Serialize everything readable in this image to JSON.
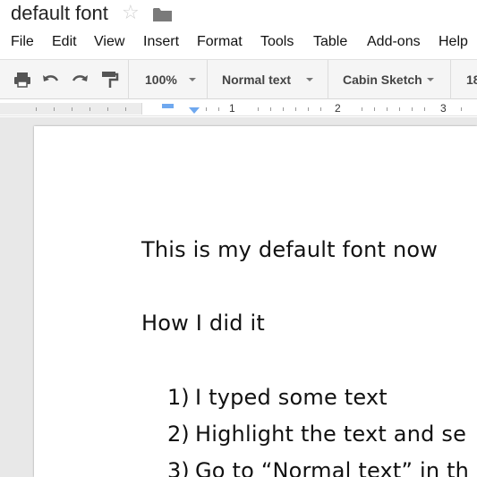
{
  "app": {
    "doc_title": "default font"
  },
  "menu": [
    "File",
    "Edit",
    "View",
    "Insert",
    "Format",
    "Tools",
    "Table",
    "Add-ons",
    "Help"
  ],
  "toolbar": {
    "zoom": "100%",
    "style": "Normal text",
    "font": "Cabin Sketch",
    "font_size_partial": "18",
    "icons": [
      "print-icon",
      "undo-icon",
      "redo-icon",
      "paint-format-icon"
    ]
  },
  "ruler": {
    "labels": [
      "1",
      "2",
      "3"
    ]
  },
  "document": {
    "heading1": "This is my default font now",
    "heading2": "How I did it",
    "list": [
      {
        "num": "1)",
        "text": "I typed some text"
      },
      {
        "num": "2)",
        "text": "Highlight the text and se"
      },
      {
        "num": "3)",
        "text": "Go to “Normal text” in th"
      }
    ]
  },
  "colors": {
    "accent_blue": "#6fa8ef",
    "toolbar_bg": "#f5f5f5",
    "canvas_bg": "#e8e8e8"
  }
}
